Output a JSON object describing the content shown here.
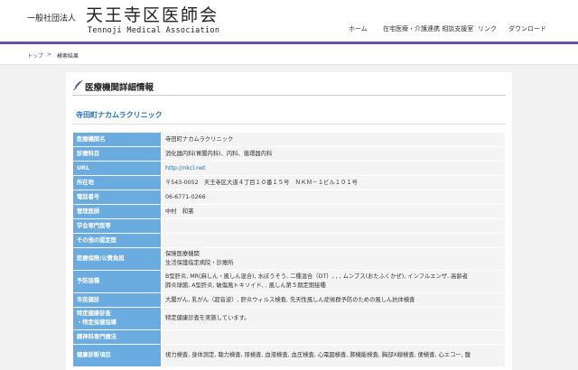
{
  "header": {
    "org_type": "一般社団法人",
    "org_name": "天王寺区医師会",
    "org_name_en": "Tennoji Medical Association",
    "nav": [
      "ホーム",
      "在宅医療・介護連携 相談支援室",
      "リンク",
      "ダウンロード"
    ]
  },
  "breadcrumb": {
    "home": "トップ",
    "separator": ">",
    "current": "検索結果"
  },
  "page_title": "医療機関詳細情報",
  "clinic_name": "寺田町ナカムラクリニック",
  "colors": {
    "accent_purple": "#6a4fa8",
    "label_blue": "#6aabe0",
    "link_blue": "#1f6fb4"
  },
  "icons": {
    "title": "quill-pen-icon"
  },
  "rows": [
    {
      "label": "医療機関名",
      "value": [
        "寺田町ナカムラクリニック"
      ],
      "h": 16
    },
    {
      "label": "診療科目",
      "value": [
        "消化器内科(胃腸内科)、内科、循環器内科"
      ],
      "h": 16
    },
    {
      "label": "URL",
      "value": [
        "http://nkcl.net"
      ],
      "link": true,
      "h": 16
    },
    {
      "label": "所在地",
      "value": [
        "〒543-0052　天王寺区大道４丁目１０番１５号　ＮＫＭ－１ビル１０１号"
      ],
      "h": 16
    },
    {
      "label": "電話番号",
      "value": [
        "06-6771-0266"
      ],
      "h": 16
    },
    {
      "label": "管理医師",
      "value": [
        "中村　和憲"
      ],
      "h": 16
    },
    {
      "label": "学会専門医等",
      "value": [
        ""
      ],
      "h": 16
    },
    {
      "label": "その他の認定医",
      "value": [
        ""
      ],
      "h": 16
    },
    {
      "label": "医療保険/公費負担",
      "value": [
        "保険医療機関",
        "生活保護指定病院・診療所"
      ],
      "h": 25
    },
    {
      "label": "予防接種",
      "value": [
        "B型肝炎, MR(麻しん・風しん混合), 水ぼうそう, 二種混合（DT）, , , ムンプス(おたふくかぜ), インフルエンザ, 高齢者",
        "肺炎球菌, A型肝炎, 破傷風トキソイド, , 風しん第５期定期接種"
      ],
      "h": 25
    },
    {
      "label": "市民健診",
      "value": [
        "大腸がん, 乳がん（超音波）, 肝炎ウィルス検査, 先天性風しん症候群予防のための風しん抗体検査"
      ],
      "h": 16
    },
    {
      "label": "特定健康診査\n・特定保健指導",
      "value": [
        "特定健康診査を実施しています。"
      ],
      "h": 25
    },
    {
      "label": "精神科専門療法",
      "value": [
        ""
      ],
      "h": 16
    },
    {
      "label": "健康診断項目",
      "value": [
        "視力検査, 身体測定, 聴力検査, 尿検査, 血液検査, 血圧検査, 心電図検査, 肺機能検査, 胸部X線検査, 便検査, 心エコー, 腹"
      ],
      "h": 25
    }
  ]
}
